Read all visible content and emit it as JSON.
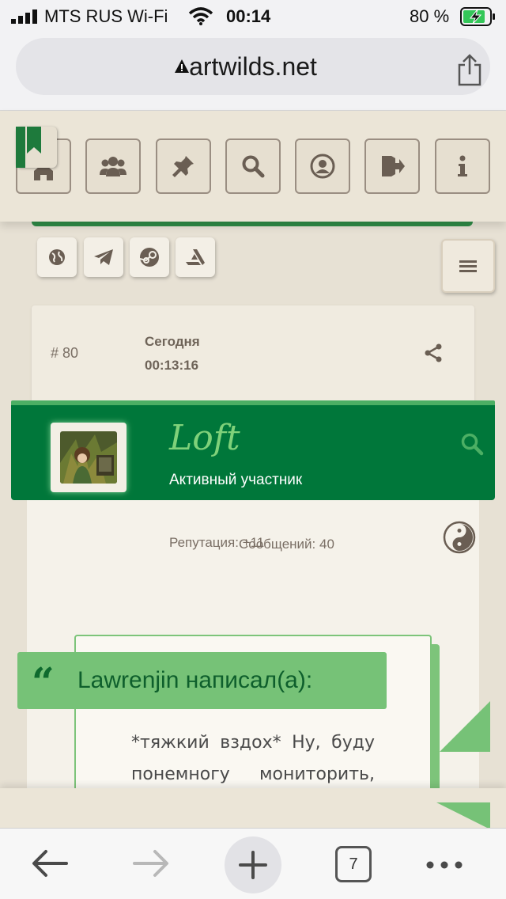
{
  "status_bar": {
    "carrier": "MTS RUS Wi-Fi",
    "time": "00:14",
    "battery_percent": "80 %"
  },
  "browser": {
    "url": "artwilds.net"
  },
  "site_nav": {
    "buttons": [
      {
        "name": "home",
        "icon": "home-icon"
      },
      {
        "name": "members",
        "icon": "users-icon"
      },
      {
        "name": "pinned",
        "icon": "pin-icon"
      },
      {
        "name": "search",
        "icon": "search-icon"
      },
      {
        "name": "profile",
        "icon": "user-circle-icon"
      },
      {
        "name": "logout",
        "icon": "sign-out-icon"
      },
      {
        "name": "info",
        "icon": "info-icon"
      }
    ],
    "social": [
      "globe-icon",
      "telegram-icon",
      "steam-icon",
      "artstation-icon"
    ],
    "menu_icon": "hamburger-icon"
  },
  "post": {
    "number": "# 80",
    "date": "Сегодня",
    "time": "00:13:16",
    "author": {
      "name": "Loft",
      "title": "Активный участник",
      "reputation": "Репутация: +11",
      "messages": "Сообщений: 40"
    },
    "quote": {
      "mark": "“",
      "author_label": "Lawrenjin написал(а):",
      "line1": "*тяжкий вздох* Ну, буду",
      "line2": "понемногу мониторить,"
    }
  },
  "toolbar": {
    "tab_count": "7"
  },
  "colors": {
    "brand_green": "#00773a",
    "light_green": "#76c277",
    "background": "#e7e1d4"
  }
}
